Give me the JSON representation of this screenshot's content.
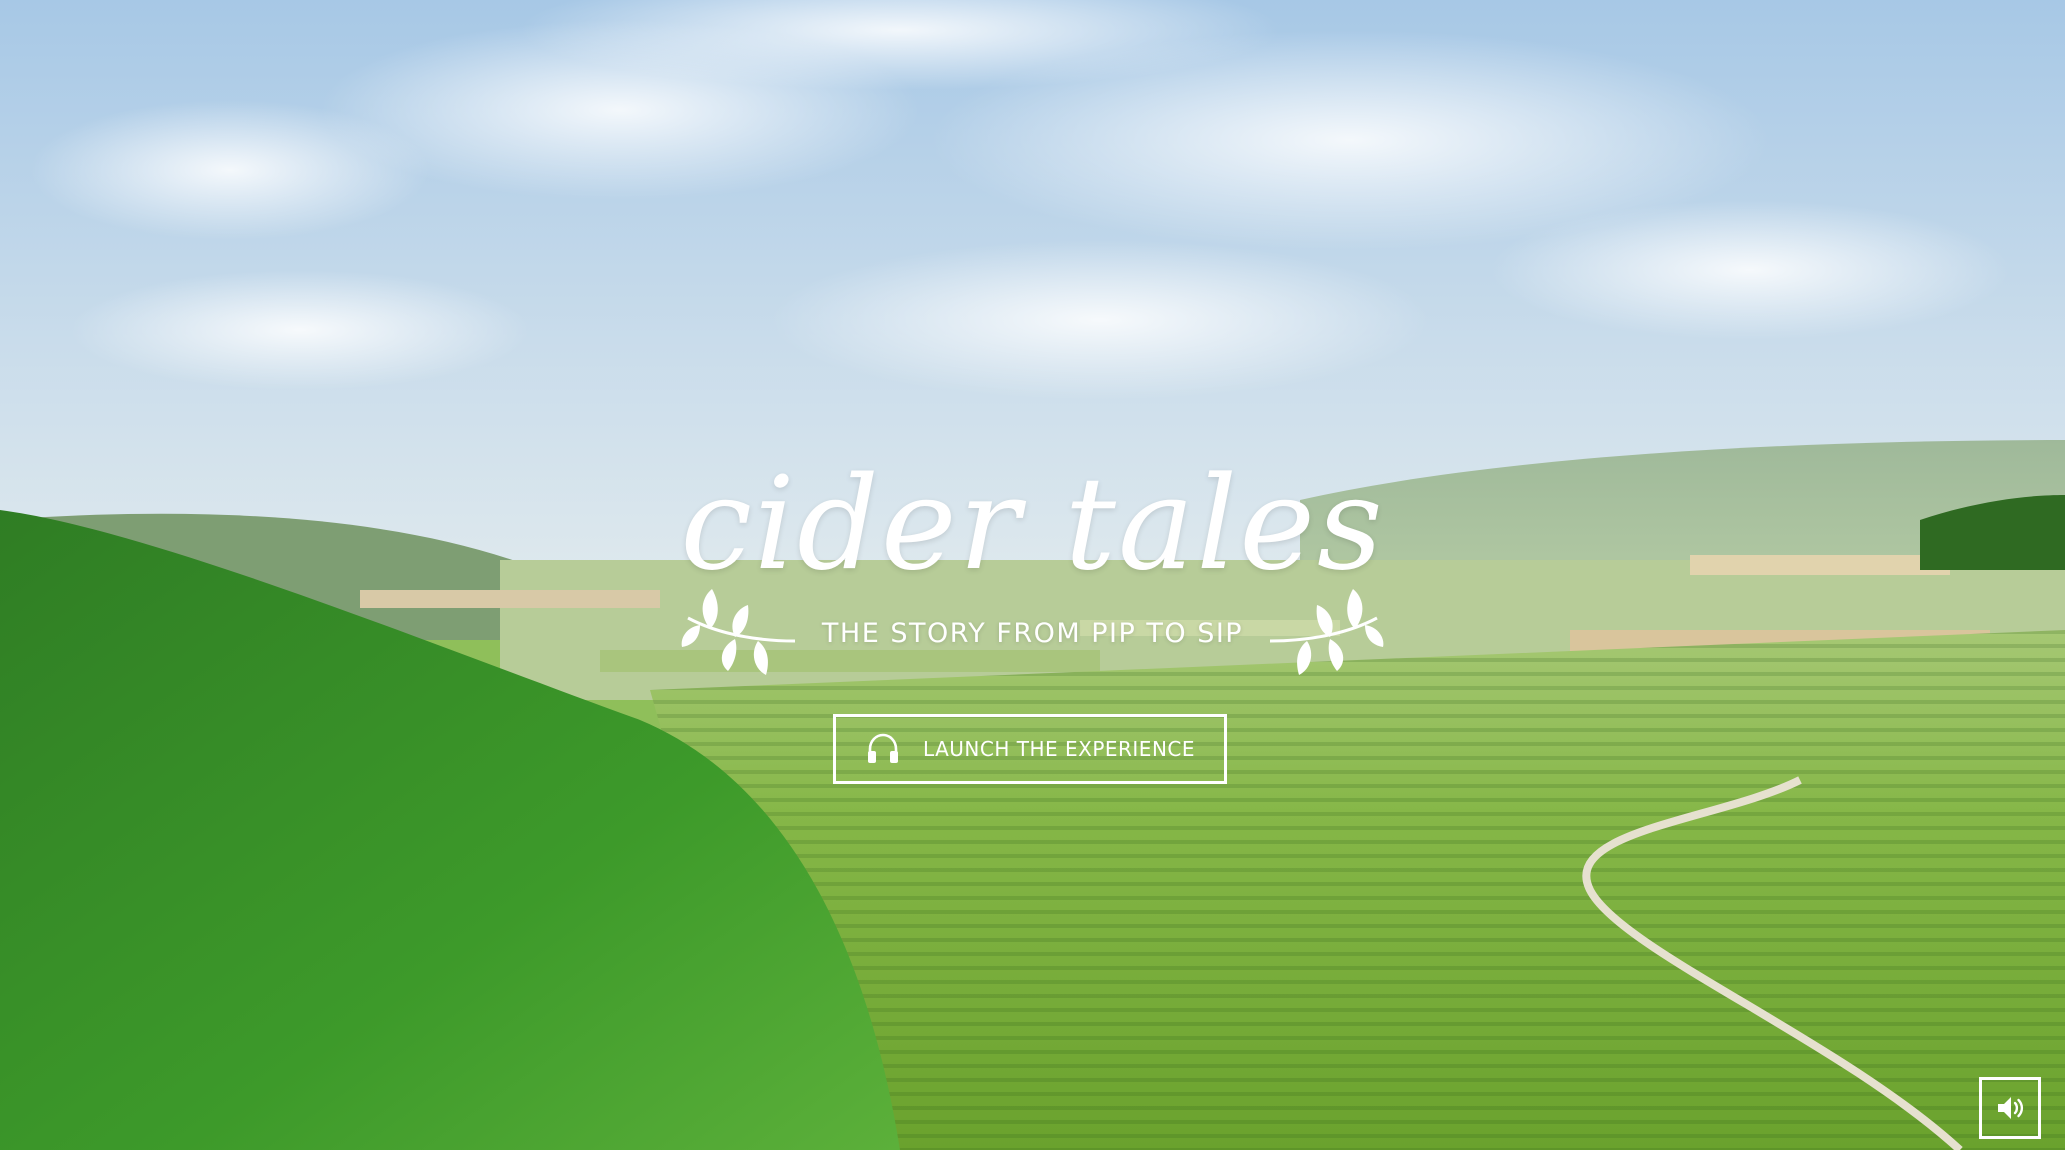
{
  "hero": {
    "title": "cider tales",
    "tagline": "THE STORY FROM PIP TO SIP"
  },
  "launch_button": {
    "label": "LAUNCH THE EXPERIENCE",
    "icon": "headphones-icon"
  },
  "sound_button": {
    "icon": "speaker-volume-icon"
  },
  "colors": {
    "sky_top": "#a9c9e4",
    "sky_bottom": "#dbe7ee",
    "orchard": "#7fb43c",
    "forest": "#3f8f2a",
    "text": "#ffffff"
  }
}
